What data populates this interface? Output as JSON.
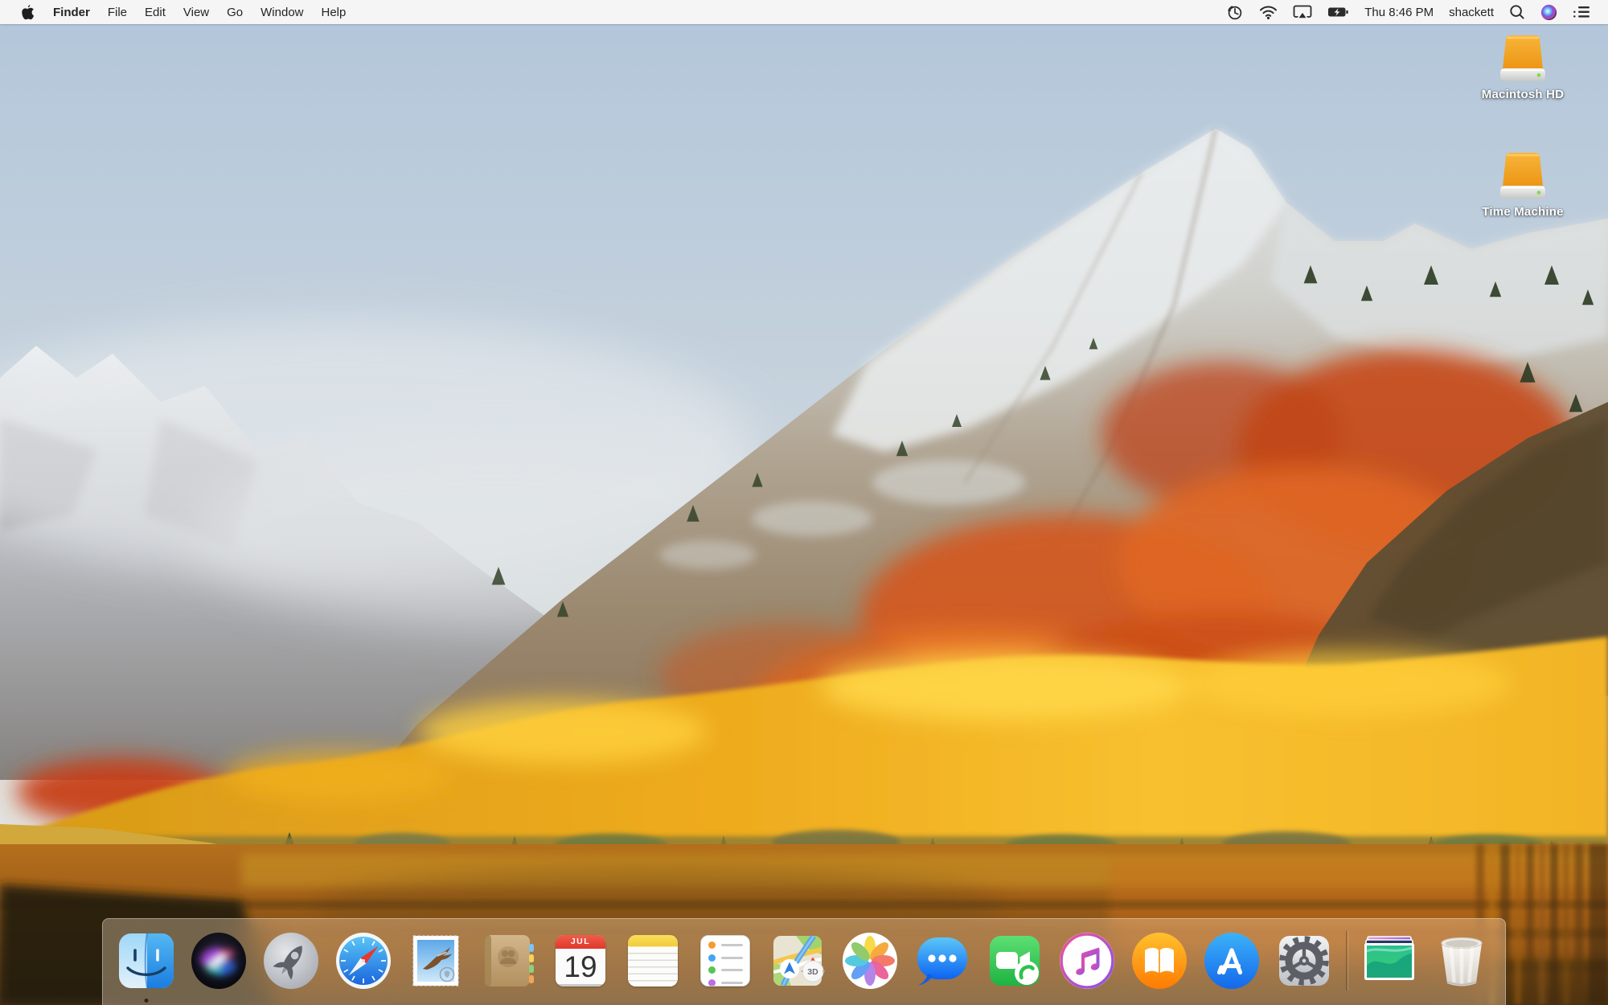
{
  "menu_bar": {
    "apple_icon": "apple-logo",
    "menus": [
      "Finder",
      "File",
      "Edit",
      "View",
      "Go",
      "Window",
      "Help"
    ],
    "active_app": "Finder",
    "status_icons": [
      "time-machine",
      "wifi",
      "airplay-display",
      "battery-charging",
      "spotlight-search",
      "siri",
      "notification-center"
    ],
    "clock": "Thu 8:46 PM",
    "username": "shackett"
  },
  "desktop": {
    "wallpaper": "macos-high-sierra-autumn-mountain-lake",
    "icons": [
      {
        "name": "macintosh-hd",
        "label": "Macintosh HD",
        "kind": "external-drive"
      },
      {
        "name": "time-machine",
        "label": "Time Machine",
        "kind": "external-drive"
      }
    ]
  },
  "dock": {
    "items": [
      "finder",
      "siri",
      "launchpad",
      "safari",
      "mail",
      "contacts",
      "calendar",
      "notes",
      "reminders",
      "maps",
      "photos",
      "messages",
      "facetime",
      "itunes",
      "ibooks",
      "app-store",
      "system-preferences",
      "separator",
      "desktop-pictures-stack",
      "trash"
    ],
    "running_apps": [
      "finder"
    ],
    "calendar_badge": {
      "month": "JUL",
      "day": "19"
    },
    "maps_badge": "3D",
    "trash_state": "empty"
  },
  "colors": {
    "menu_bar_bg": "#f7f7f7",
    "menu_text": "#242424",
    "sky": "#b6c8d8",
    "autumn_orange": "#e06622",
    "autumn_yellow": "#f2b41e",
    "water_brown": "#8a5a1a",
    "drive_orange": "#f2a62c",
    "label_text": "#ffffff"
  }
}
